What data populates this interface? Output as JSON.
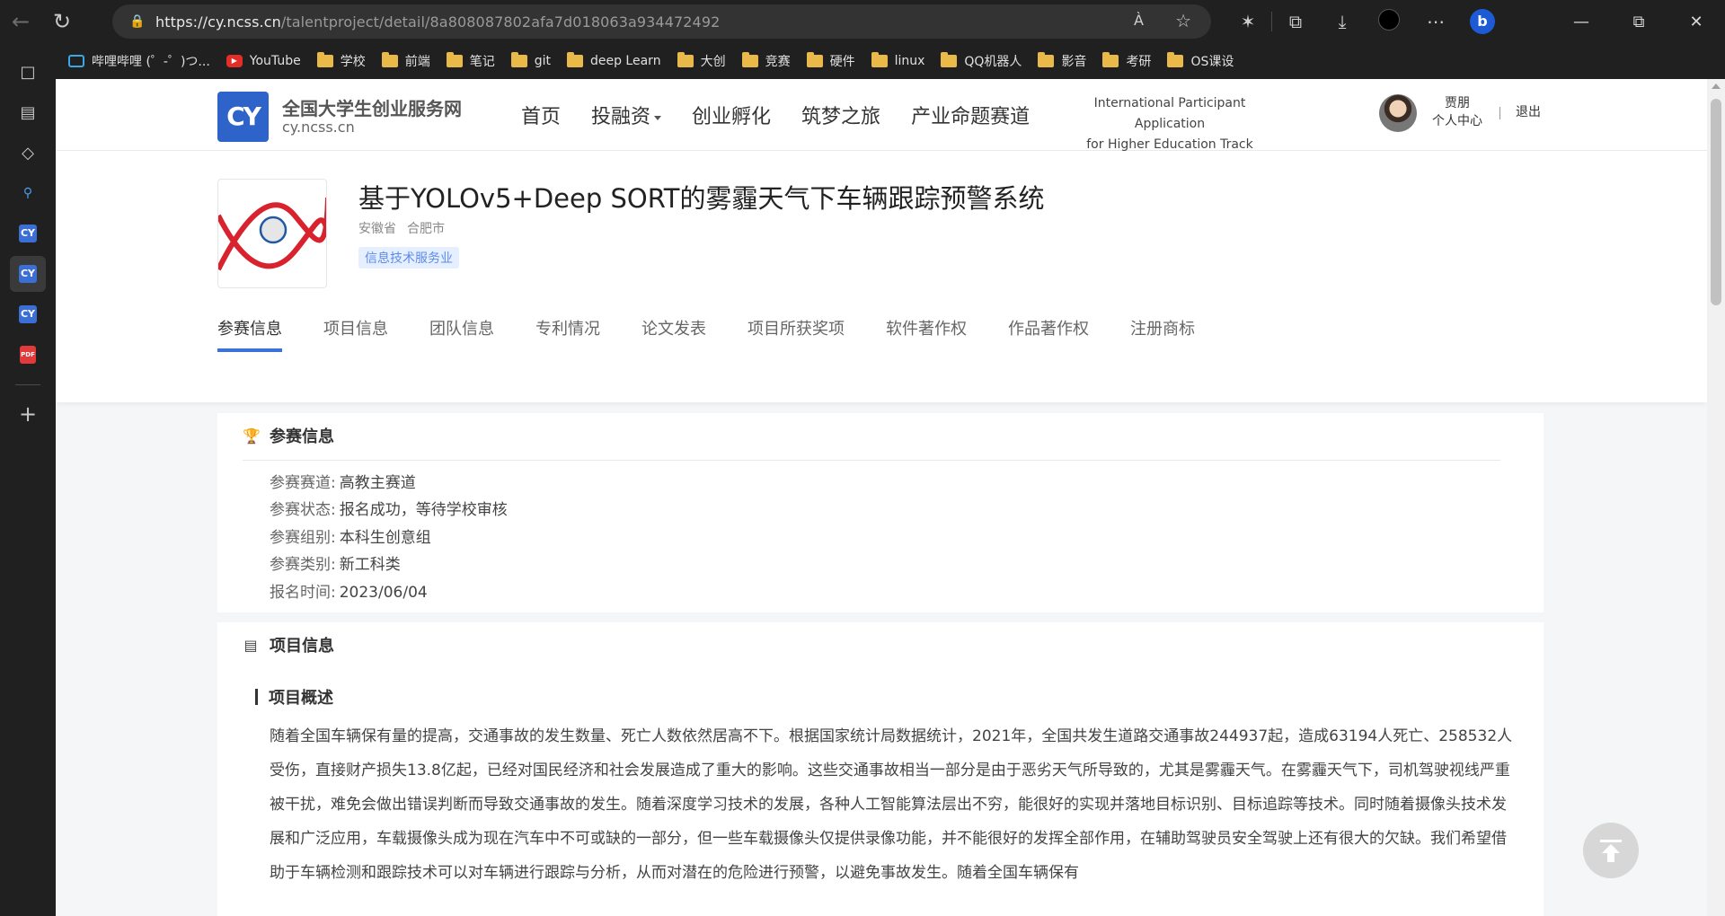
{
  "browser": {
    "url_host": "https://cy.ncss.cn",
    "url_path": "/talentproject/detail/8a808087802afa7d018063a934472492",
    "read_aloud_label": "À",
    "bookmarks": [
      {
        "label": "哔哩哔哩 (゜-゜)つ...",
        "icon": "bilibili-icon"
      },
      {
        "label": "YouTube",
        "icon": "youtube-icon"
      },
      {
        "label": "学校",
        "icon": "folder-icon"
      },
      {
        "label": "前端",
        "icon": "folder-icon"
      },
      {
        "label": "笔记",
        "icon": "folder-icon"
      },
      {
        "label": "git",
        "icon": "folder-icon"
      },
      {
        "label": "deep Learn",
        "icon": "folder-icon"
      },
      {
        "label": "大创",
        "icon": "folder-icon"
      },
      {
        "label": "竞赛",
        "icon": "folder-icon"
      },
      {
        "label": "硬件",
        "icon": "folder-icon"
      },
      {
        "label": "linux",
        "icon": "folder-icon"
      },
      {
        "label": "QQ机器人",
        "icon": "folder-icon"
      },
      {
        "label": "影音",
        "icon": "folder-icon"
      },
      {
        "label": "考研",
        "icon": "folder-icon"
      },
      {
        "label": "OS课设",
        "icon": "folder-icon"
      }
    ],
    "sidebar_cy_label": "CY",
    "sidebar_pdf_label": "PDF"
  },
  "header": {
    "logo_text": "CY",
    "site_name": "全国大学生创业服务网",
    "site_domain": "cy.ncss.cn",
    "nav": [
      "首页",
      "投融资",
      "创业孵化",
      "筑梦之旅",
      "产业命题赛道"
    ],
    "intl_line1": "International Participant Application",
    "intl_line2": "for Higher Education Track",
    "user_name": "贾朋",
    "user_center": "个人中心",
    "logout": "退出"
  },
  "project": {
    "title": "基于YOLOv5+Deep SORT的雾霾天气下车辆跟踪预警系统",
    "province": "安徽省",
    "city": "合肥市",
    "industry_tag": "信息技术服务业",
    "tabs": [
      "参赛信息",
      "项目信息",
      "团队信息",
      "专利情况",
      "论文发表",
      "项目所获奖项",
      "软件著作权",
      "作品著作权",
      "注册商标"
    ],
    "active_tab": "参赛信息"
  },
  "competition": {
    "title": "参赛信息",
    "rows": [
      {
        "label": "参赛赛道:",
        "value": "高教主赛道"
      },
      {
        "label": "参赛状态:",
        "value": "报名成功，等待学校审核"
      },
      {
        "label": "参赛组别:",
        "value": "本科生创意组"
      },
      {
        "label": "参赛类别:",
        "value": "新工科类"
      },
      {
        "label": "报名时间:",
        "value": "2023/06/04"
      }
    ]
  },
  "project_info": {
    "title": "项目信息",
    "overview_title": "项目概述",
    "overview_text": "随着全国车辆保有量的提高，交通事故的发生数量、死亡人数依然居高不下。根据国家统计局数据统计，2021年，全国共发生道路交通事故244937起，造成63194人死亡、258532人受伤，直接财产损失13.8亿起，已经对国民经济和社会发展造成了重大的影响。这些交通事故相当一部分是由于恶劣天气所导致的，尤其是雾霾天气。在雾霾天气下，司机驾驶视线严重被干扰，难免会做出错误判断而导致交通事故的发生。随着深度学习技术的发展，各种人工智能算法层出不穷，能很好的实现并落地目标识别、目标追踪等技术。同时随着摄像头技术发展和广泛应用，车载摄像头成为现在汽车中不可或缺的一部分，但一些车载摄像头仅提供录像功能，并不能很好的发挥全部作用，在辅助驾驶员安全驾驶上还有很大的欠缺。我们希望借助于车辆检测和跟踪技术可以对车辆进行跟踪与分析，从而对潜在的危险进行预警，以避免事故发生。随着全国车辆保有"
  }
}
